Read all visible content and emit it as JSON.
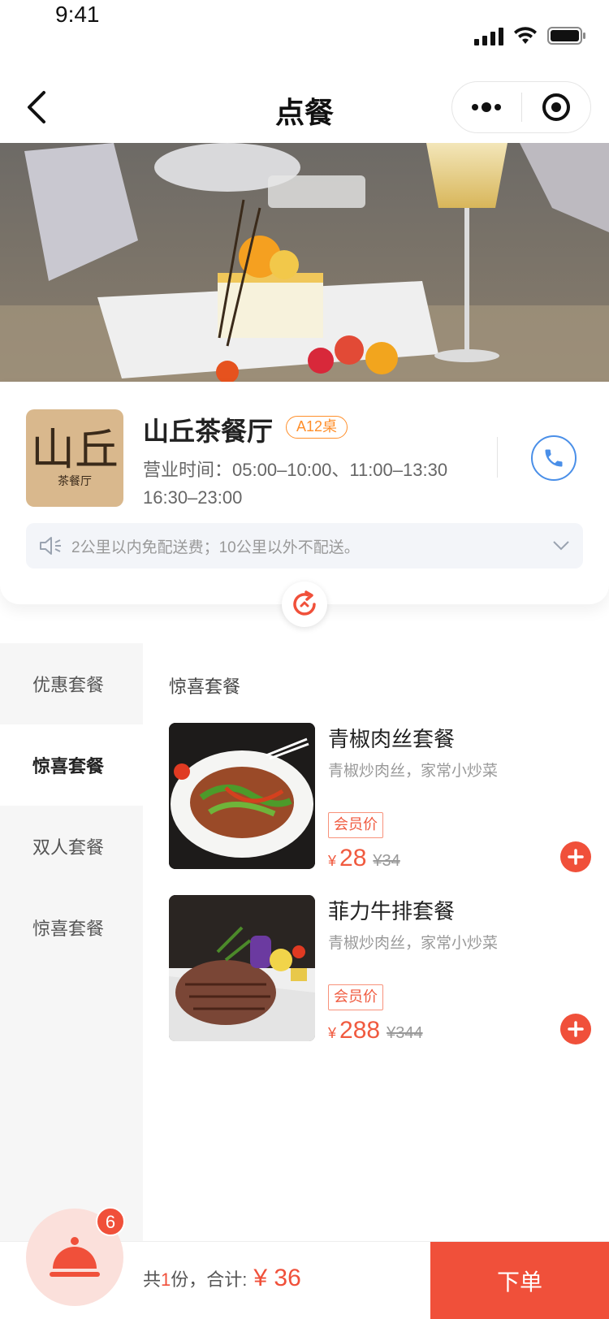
{
  "status_bar": {
    "time": "9:41"
  },
  "nav": {
    "title": "点餐"
  },
  "shop": {
    "logo_text": "山丘",
    "logo_sub": "茶餐厅",
    "name": "山丘茶餐厅",
    "table": "A12桌",
    "hours_label": "营业时间：",
    "hours_line1": "05:00–10:00、11:00–13:30",
    "hours_line2": "16:30–23:00",
    "notice": "2公里以内免配送费；10公里以外不配送。"
  },
  "sidebar": {
    "items": [
      {
        "label": "优惠套餐"
      },
      {
        "label": "惊喜套餐"
      },
      {
        "label": "双人套餐"
      },
      {
        "label": "惊喜套餐"
      }
    ]
  },
  "content": {
    "section_title": "惊喜套餐",
    "dishes": [
      {
        "name": "青椒肉丝套餐",
        "desc": "青椒炒肉丝，家常小炒菜",
        "member_label": "会员价",
        "currency": "¥",
        "price": "28",
        "old_price": "¥34"
      },
      {
        "name": "菲力牛排套餐",
        "desc": "青椒炒肉丝，家常小炒菜",
        "member_label": "会员价",
        "currency": "¥",
        "price": "288",
        "old_price": "¥344"
      }
    ]
  },
  "cart": {
    "badge": "6",
    "total_prefix": "共",
    "total_count": "1",
    "total_mid": "份，合计:",
    "total_amount": "¥ 36",
    "order_label": "下单"
  },
  "colors": {
    "accent": "#f0503a",
    "phone_blue": "#4a8fe8",
    "badge_orange": "#ff8f2b"
  }
}
